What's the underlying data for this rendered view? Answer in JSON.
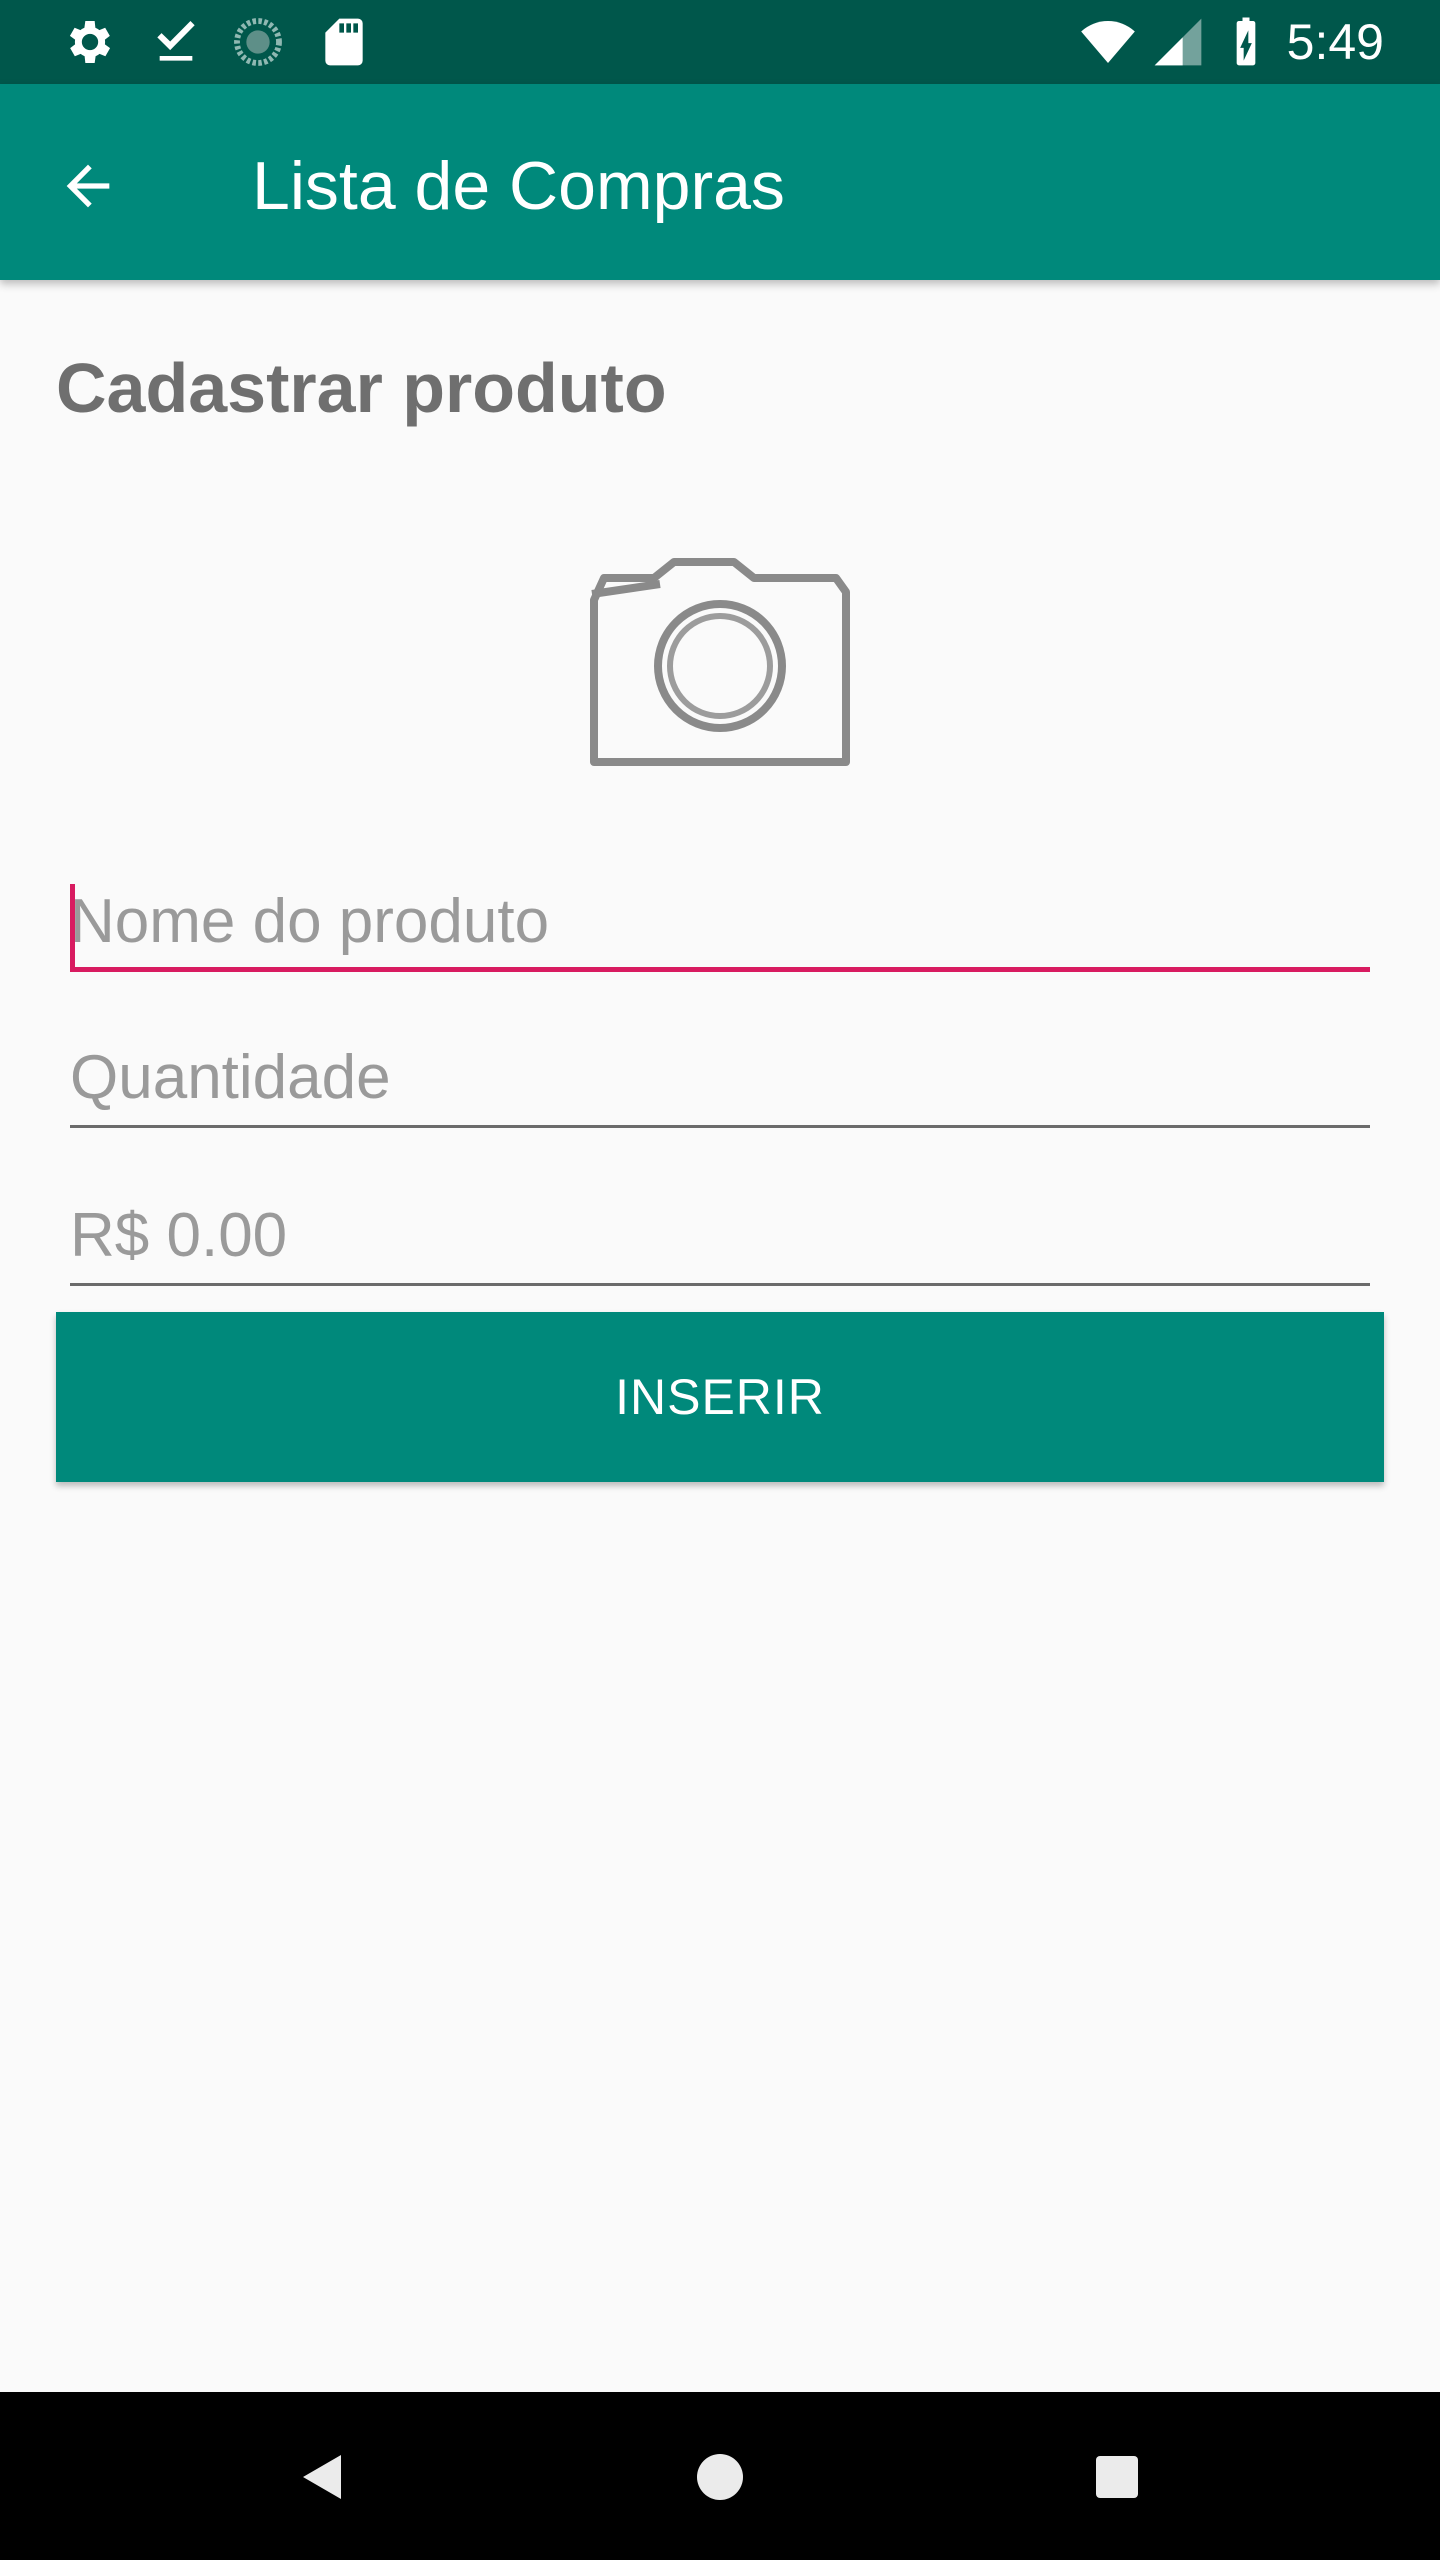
{
  "status_bar": {
    "time": "5:49",
    "icons": [
      "settings-icon",
      "download-done-icon",
      "sync-circle-icon",
      "sd-card-icon",
      "wifi-icon",
      "signal-icon",
      "battery-charging-icon"
    ]
  },
  "app_bar": {
    "title": "Lista de Compras",
    "back_icon": "arrow-back-icon"
  },
  "form": {
    "section_title": "Cadastrar produto",
    "image_icon": "camera-icon",
    "name_placeholder": "Nome do produto",
    "name_value": "",
    "quantity_placeholder": "Quantidade",
    "quantity_value": "",
    "price_placeholder": "R$ 0.00",
    "price_value": "",
    "insert_label": "INSERIR"
  },
  "nav_bar": {
    "icons": [
      "back-triangle-icon",
      "home-circle-icon",
      "recents-square-icon"
    ]
  },
  "colors": {
    "primary": "#00897b",
    "primary_dark": "#00574b",
    "accent": "#d81b60",
    "background": "#fafafa"
  }
}
